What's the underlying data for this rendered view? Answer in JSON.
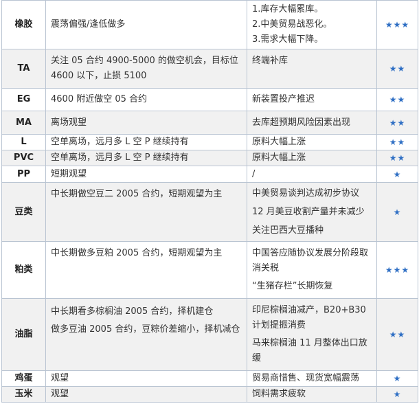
{
  "rows": [
    {
      "name": "橡胶",
      "strategy": [
        "震荡偏强/逢低做多"
      ],
      "logic": [
        "1.库存大幅累库。",
        "2.中美贸易战恶化。",
        "3.需求大幅下降。"
      ],
      "stars": "★★★"
    },
    {
      "name": "TA",
      "strategy": [
        "关注 05 合约 4900-5000 的做空机会，目标位",
        "4600 以下，止损 5100"
      ],
      "logic": [
        "终端补库"
      ],
      "stars": "★★"
    },
    {
      "name": "EG",
      "strategy": [
        "4600 附近做空 05 合约"
      ],
      "logic": [
        "新装置投产推迟"
      ],
      "stars": "★★"
    },
    {
      "name": "MA",
      "strategy": [
        "离场观望"
      ],
      "logic": [
        "去库超预期风险因素出现"
      ],
      "stars": "★★"
    },
    {
      "name": "L",
      "strategy": [
        "空单离场，远月多 L 空 P 继续持有"
      ],
      "logic": [
        "原料大幅上涨"
      ],
      "stars": "★★"
    },
    {
      "name": "PVC",
      "strategy": [
        "空单离场，远月多 L 空 P 继续持有"
      ],
      "logic": [
        "原料大幅上涨"
      ],
      "stars": "★★"
    },
    {
      "name": "PP",
      "strategy": [
        "短期观望"
      ],
      "logic": [
        "/"
      ],
      "stars": "★"
    },
    {
      "name": "豆类",
      "strategy": [
        "中长期做空豆二 2005 合约，短期观望为主"
      ],
      "logic": [
        "中美贸易谈判达成初步协议",
        "12 月美豆收割产量并未减少",
        "关注巴西大豆播种"
      ],
      "stars": "★"
    },
    {
      "name": "粕类",
      "strategy": [
        "中长期做多豆粕 2005 合约，短期观望为主"
      ],
      "logic": [
        "中国答应随协议发展分阶段取消关税",
        "“生猪存栏”长期恢复"
      ],
      "stars": "★★★"
    },
    {
      "name": "油脂",
      "strategy": [
        "中长期看多棕榈油 2005 合约，择机建仓",
        "做多豆油 2005 合约，豆粽价差缩小，择机减仓"
      ],
      "logic": [
        "印尼棕榈油减产，B20+B30 计划提振消费",
        "马来棕榈油 11 月整体出口放缓"
      ],
      "stars": "★★"
    },
    {
      "name": "鸡蛋",
      "strategy": [
        "观望"
      ],
      "logic": [
        "贸易商惜售、现货宽幅震荡"
      ],
      "stars": "★"
    },
    {
      "name": "玉米",
      "strategy": [
        "观望"
      ],
      "logic": [
        "饲料需求疲软"
      ],
      "stars": "★"
    }
  ]
}
